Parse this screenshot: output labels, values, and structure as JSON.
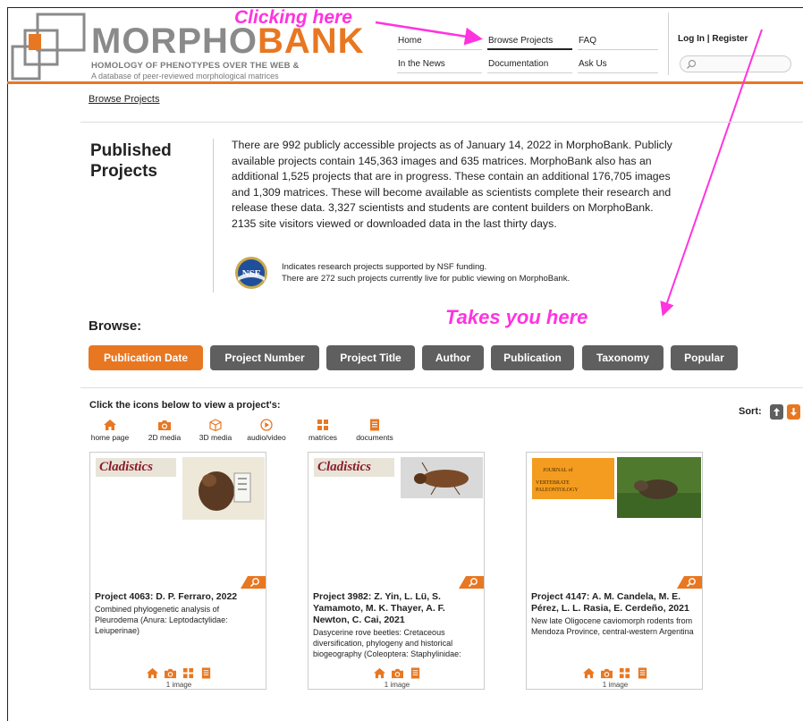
{
  "header": {
    "logo_word_part1": "MORPHO",
    "logo_word_part2": "BANK",
    "tagline": "HOMOLOGY OF PHENOTYPES OVER THE WEB &",
    "subtagline": "A database of peer-reviewed morphological matrices",
    "nav": {
      "home": "Home",
      "browse_projects": "Browse Projects",
      "faq": "FAQ",
      "in_the_news": "In the News",
      "documentation": "Documentation",
      "ask_us": "Ask Us"
    },
    "login": "Log In | Register",
    "search_placeholder": ""
  },
  "annotations": {
    "clicking_here": "Clicking here",
    "takes_you_here": "Takes you here"
  },
  "breadcrumb": "Browse Projects",
  "intro": {
    "title": "Published Projects",
    "description": "There are 992 publicly accessible projects as of January 14, 2022 in MorphoBank. Publicly available projects contain 145,363 images and 635 matrices. MorphoBank also has an additional 1,525 projects that are in progress. These contain an additional 176,705 images and 1,309 matrices. These will become available as scientists complete their research and release these data. 3,327 scientists and students are content builders on MorphoBank. 2135 site visitors viewed or downloaded data in the last thirty days.",
    "nsf_logo_text": "NSF",
    "nsf_line1": "Indicates research projects supported by NSF funding.",
    "nsf_line2": "There are 272 such projects currently live for public viewing on MorphoBank."
  },
  "browse": {
    "heading": "Browse:",
    "buttons": [
      "Publication Date",
      "Project Number",
      "Project Title",
      "Author",
      "Publication",
      "Taxonomy",
      "Popular"
    ],
    "active": "Publication Date"
  },
  "legend": {
    "heading": "Click the icons below to view a project's:",
    "items": [
      {
        "label": "home page",
        "icon": "home-icon"
      },
      {
        "label": "2D media",
        "icon": "camera-icon"
      },
      {
        "label": "3D media",
        "icon": "cube-icon"
      },
      {
        "label": "audio/video",
        "icon": "play-icon"
      },
      {
        "label": "matrices",
        "icon": "grid-icon"
      },
      {
        "label": "documents",
        "icon": "document-icon"
      }
    ]
  },
  "sort": {
    "label": "Sort:"
  },
  "colors": {
    "accent": "#e87722",
    "annotation": "#ff33e0",
    "button_gray": "#5f5f5f"
  },
  "projects": [
    {
      "journal": "Cladistics",
      "title": "Project 4063: D. P. Ferraro, 2022",
      "description": "Combined phylogenetic analysis of Pleurodema (Anura: Leptodactylidae: Leiuperinae)",
      "media_count": "1 image"
    },
    {
      "journal": "Cladistics",
      "title": "Project 3982: Z. Yin, L. Lü, S. Yamamoto, M. K. Thayer, A. F. Newton, C. Cai, 2021",
      "description": "Dasycerine rove beetles: Cretaceous diversification, phylogeny and historical biogeography (Coleoptera: Staphylinidae:",
      "media_count": "1 image"
    },
    {
      "journal_line1": "JOURNAL of",
      "journal_line2": "VERTEBRATE PALEONTOLOGY",
      "title": "Project 4147: A. M. Candela, M. E. Pérez, L. L. Rasia, E. Cerdeño, 2021",
      "description": "New late Oligocene caviomorph rodents from Mendoza Province, central-western Argentina",
      "media_count": "1 image"
    }
  ]
}
